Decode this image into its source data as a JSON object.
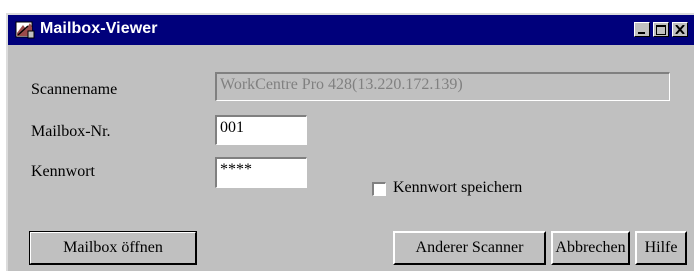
{
  "window": {
    "title": "Mailbox-Viewer",
    "icon": "mailbox-scanner-icon"
  },
  "form": {
    "scanner_label": "Scannername",
    "scanner_value": "WorkCentre Pro 428(13.220.172.139)",
    "mailbox_label": "Mailbox-Nr.",
    "mailbox_value": "001",
    "password_label": "Kennwort",
    "password_value": "****",
    "save_password_label": "Kennwort speichern",
    "save_password_checked": false
  },
  "buttons": {
    "open_mailbox": "Mailbox öffnen",
    "other_scanner": "Anderer Scanner",
    "cancel": "Abbrechen",
    "help": "Hilfe"
  },
  "colors": {
    "titlebar": "#00007b",
    "face": "#c0c0c0"
  }
}
